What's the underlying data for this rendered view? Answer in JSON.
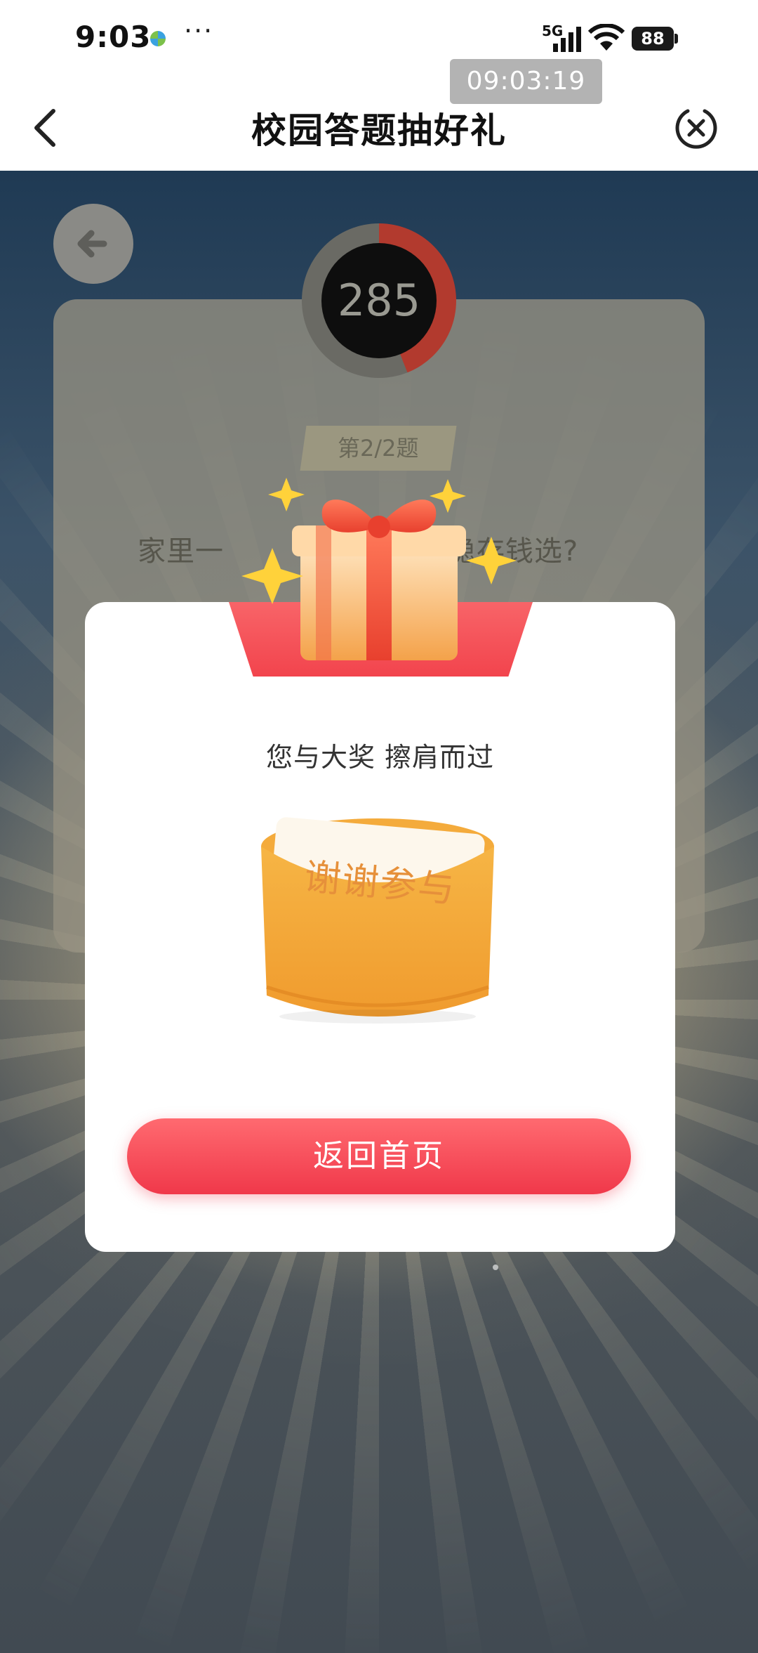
{
  "status_bar": {
    "time": "9:03",
    "more": "···",
    "network": "5G",
    "battery": "88"
  },
  "clock_overlay": "09:03:19",
  "nav": {
    "title": "校园答题抽好礼"
  },
  "quiz": {
    "timer": "285",
    "question_number": "第2/2题",
    "question_visible_start": "家里一",
    "question_visible_end": "稳存钱选?"
  },
  "modal": {
    "ribbon_label": "谢谢参与",
    "subtitle": "您与大奖 擦肩而过",
    "envelope_note": "谢谢参与",
    "button_label": "返回首页"
  },
  "colors": {
    "accent_red": "#f2444d",
    "envelope_orange": "#f2a636",
    "timer_ring": "#b23a2e"
  },
  "icons": [
    "china-mobile-icon",
    "signal-icon",
    "wifi-icon",
    "battery-icon",
    "chevron-left-icon",
    "close-circle-icon",
    "back-arrow-icon",
    "gift-box-icon",
    "star-icon",
    "envelope-icon"
  ]
}
